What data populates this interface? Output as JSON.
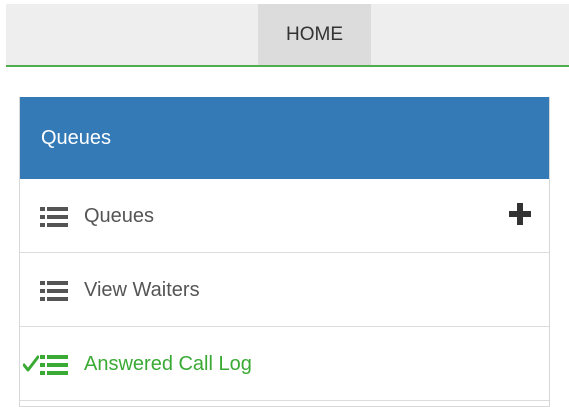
{
  "nav": {
    "home_label": "HOME"
  },
  "panel": {
    "title": "Queues",
    "items": [
      {
        "label": "Queues",
        "icon": "list-icon",
        "action_icon": "plus-icon"
      },
      {
        "label": "View Waiters",
        "icon": "list-icon"
      },
      {
        "label": "Answered Call Log",
        "icon": "list-icon",
        "status_icon": "check-icon",
        "active": true
      }
    ]
  },
  "colors": {
    "accent_blue": "#337ab7",
    "active_green": "#3aaa35",
    "nav_border_green": "#4cae4c"
  }
}
